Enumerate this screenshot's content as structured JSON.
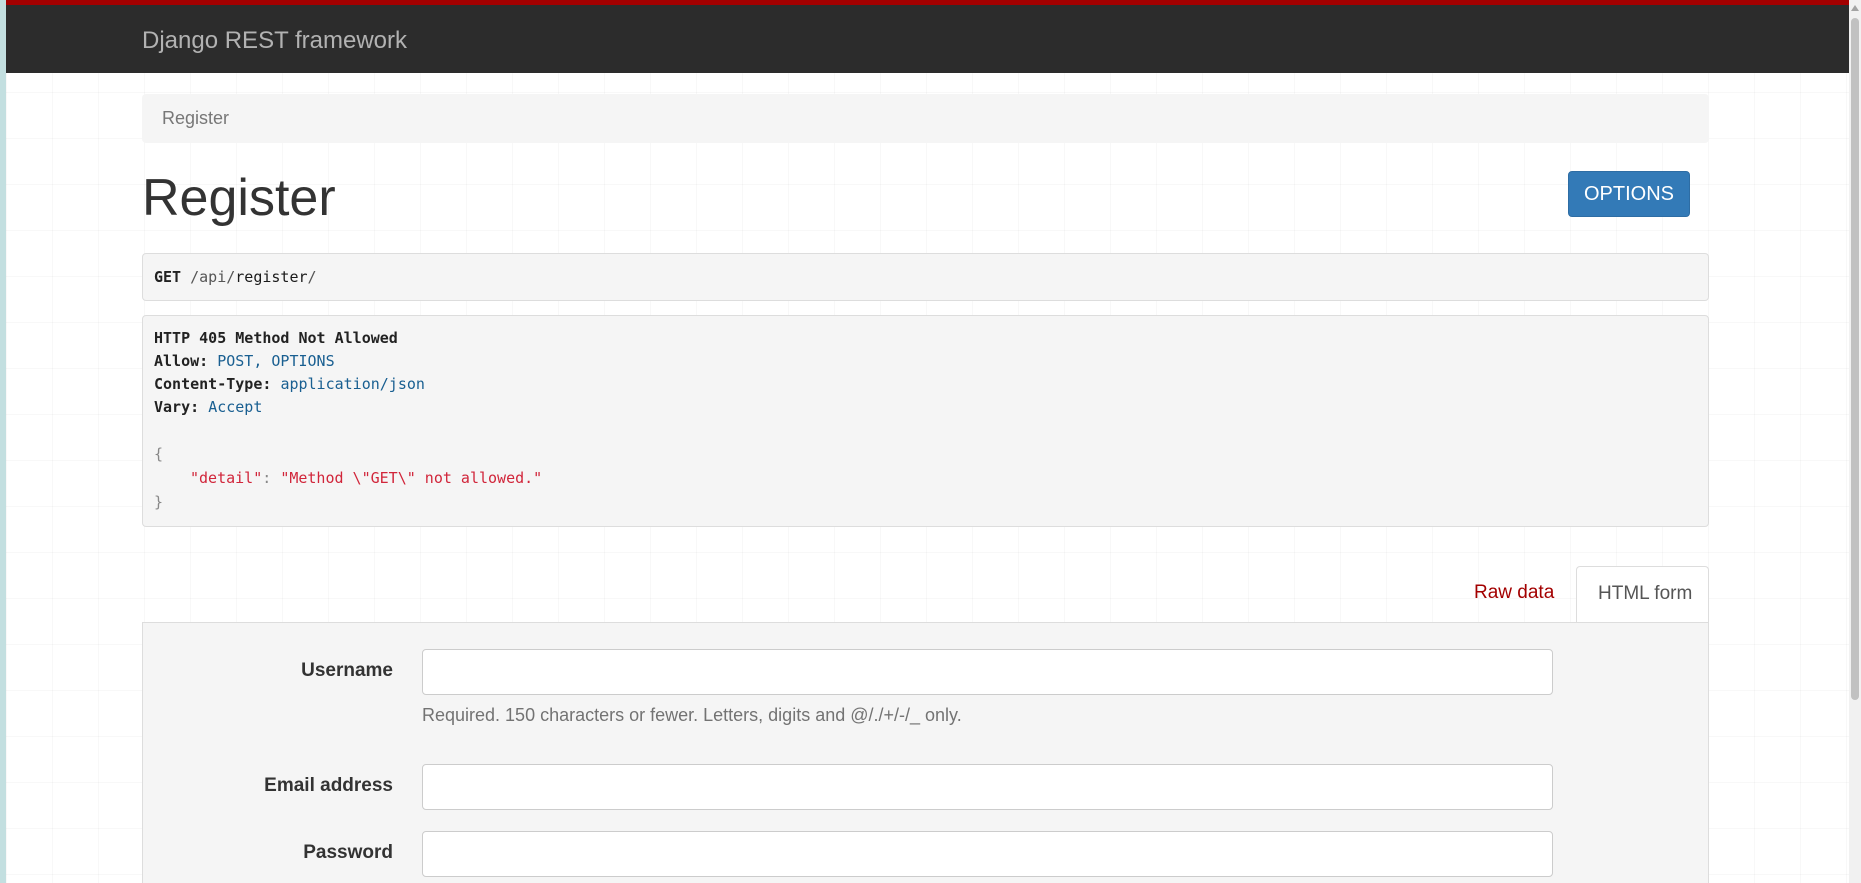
{
  "navbar": {
    "brand": "Django REST framework"
  },
  "breadcrumb": {
    "current": "Register"
  },
  "header": {
    "title": "Register",
    "options_label": "OPTIONS"
  },
  "request": {
    "method": "GET",
    "path_segments": [
      "api",
      "register"
    ]
  },
  "response": {
    "status": "HTTP 405 Method Not Allowed",
    "headers": [
      {
        "name": "Allow:",
        "value": "POST, OPTIONS"
      },
      {
        "name": "Content-Type:",
        "value": "application/json"
      },
      {
        "name": "Vary:",
        "value": "Accept"
      }
    ],
    "body": {
      "open": "{",
      "key": "\"detail\"",
      "colon": ":",
      "value": "\"Method \\\"GET\\\" not allowed.\"",
      "close": "}"
    }
  },
  "tabs": {
    "raw": "Raw data",
    "html": "HTML form"
  },
  "form": {
    "username": {
      "label": "Username",
      "value": "",
      "help": "Required. 150 characters or fewer. Letters, digits and @/./+/-/_ only."
    },
    "email": {
      "label": "Email address",
      "value": ""
    },
    "password": {
      "label": "Password",
      "value": ""
    }
  },
  "colors": {
    "navbar_bg": "#2c2c2c",
    "navbar_accent": "#a30000",
    "primary_button": "#337ab7",
    "tab_link": "#a30000",
    "json_string": "#d1253a",
    "header_value": "#195f91"
  }
}
